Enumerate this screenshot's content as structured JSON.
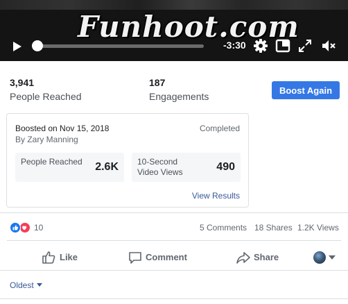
{
  "video": {
    "watermark": "Funhoot.com",
    "time_remaining": "-3:30",
    "progress": 0.02,
    "controls": [
      "play-icon",
      "settings-gear-icon",
      "picture-in-picture-icon",
      "fullscreen-icon",
      "volume-muted-icon"
    ]
  },
  "stats": {
    "people_reached": {
      "value": "3,941",
      "label": "People Reached"
    },
    "engagements": {
      "value": "187",
      "label": "Engagements"
    },
    "boost_button": "Boost Again"
  },
  "boost_card": {
    "title": "Boosted on Nov 15, 2018",
    "author": "By Zary Manning",
    "status": "Completed",
    "metrics": [
      {
        "label": "People Reached",
        "value": "2.6K"
      },
      {
        "label": "10-Second Video Views",
        "value": "490"
      }
    ],
    "view_results": "View Results"
  },
  "engagement": {
    "reaction_count": "10",
    "reaction_icons": [
      "like-reaction-icon",
      "love-reaction-icon"
    ],
    "comments": "5 Comments",
    "shares": "18 Shares",
    "views": "1.2K Views"
  },
  "actions": {
    "like": "Like",
    "comment": "Comment",
    "share": "Share"
  },
  "comments_sort": {
    "selected": "Oldest"
  },
  "colors": {
    "primary_button": "#3578e5",
    "link": "#385898",
    "like_blue": "#1877f2",
    "love_red": "#f33e58"
  }
}
